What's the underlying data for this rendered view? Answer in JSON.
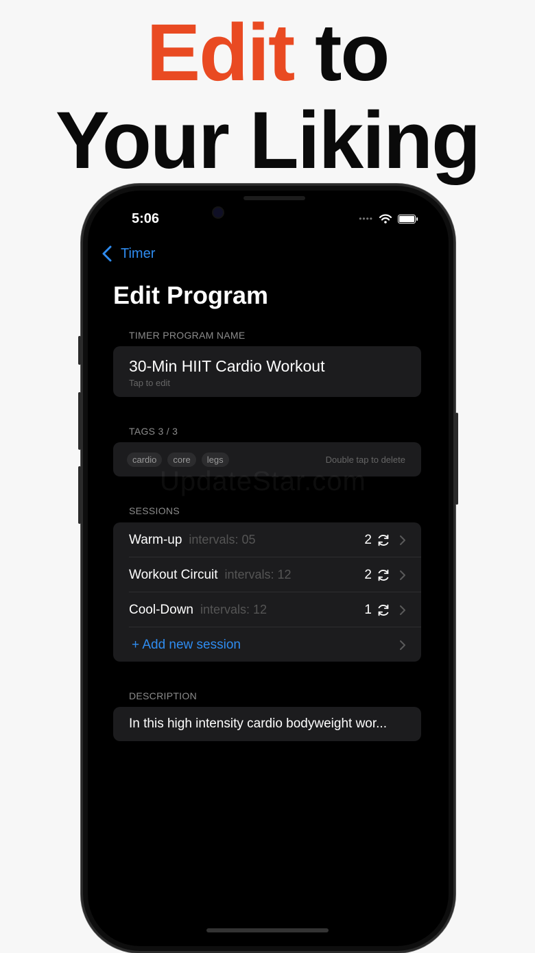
{
  "headline": {
    "accent": "Edit",
    "rest1": " to",
    "line2": "Your Liking"
  },
  "status": {
    "time": "5:06",
    "dots": "••••"
  },
  "nav": {
    "back_label": "Timer",
    "title": "Edit Program"
  },
  "program_name": {
    "section": "TIMER PROGRAM NAME",
    "value": "30-Min HIIT Cardio Workout",
    "hint": "Tap to edit"
  },
  "tags": {
    "section": "TAGS 3 / 3",
    "items": [
      "cardio",
      "core",
      "legs"
    ],
    "hint": "Double tap to delete"
  },
  "sessions": {
    "section": "SESSIONS",
    "items": [
      {
        "name": "Warm-up",
        "meta": "intervals: 05",
        "count": "2"
      },
      {
        "name": "Workout Circuit",
        "meta": "intervals: 12",
        "count": "2"
      },
      {
        "name": "Cool-Down",
        "meta": "intervals: 12",
        "count": "1"
      }
    ],
    "add_label": "+ Add new session"
  },
  "description": {
    "section": "DESCRIPTION",
    "value": "In this high intensity cardio bodyweight wor..."
  },
  "watermark": "UpdateStar.com",
  "colors": {
    "accent": "#e94a22",
    "link": "#2f8cf0",
    "card": "#1c1c1e"
  },
  "icons": {
    "back": "chevron-left-icon",
    "repeat": "repeat-cycle-icon",
    "row": "chevron-right-icon"
  }
}
